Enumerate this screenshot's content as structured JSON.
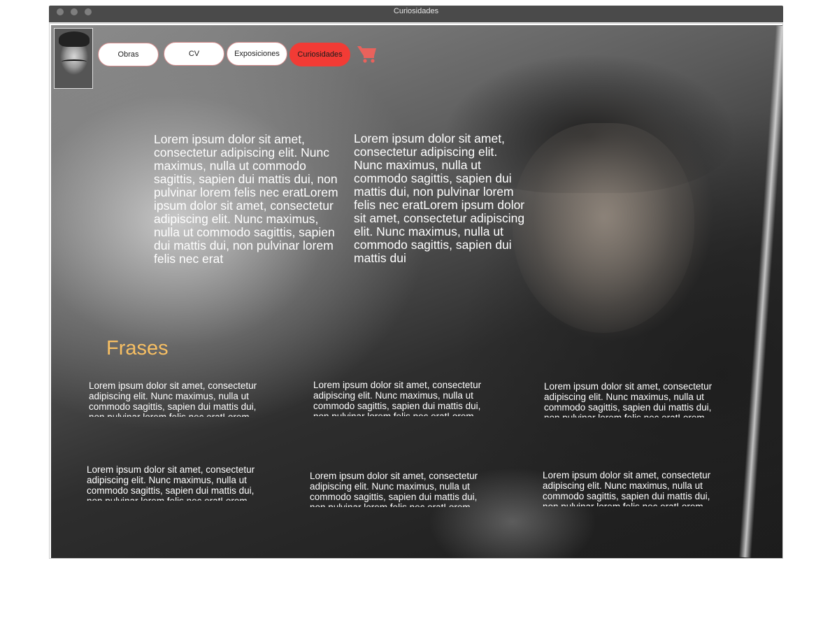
{
  "window": {
    "title": "Curiosidades"
  },
  "nav": {
    "items": [
      {
        "label": "Obras"
      },
      {
        "label": "CV"
      },
      {
        "label": "Exposiciones"
      },
      {
        "label": "Curiosidades",
        "active": true
      }
    ],
    "cart_icon": "shopping-cart-icon",
    "accent_color": "#f23b35"
  },
  "intro": {
    "col1": "Lorem ipsum dolor sit amet, consectetur adipiscing elit. Nunc maximus, nulla ut commodo sagittis, sapien dui mattis dui, non pulvinar lorem felis nec eratLorem ipsum dolor sit amet, consectetur adipiscing elit. Nunc maximus, nulla ut commodo sagittis, sapien dui mattis dui, non pulvinar lorem felis nec erat",
    "col2": "Lorem ipsum dolor sit amet, consectetur adipiscing elit. Nunc maximus, nulla ut commodo sagittis, sapien dui mattis dui, non pulvinar lorem felis nec eratLorem ipsum dolor sit amet, consectetur adipiscing elit. Nunc maximus, nulla ut commodo sagittis, sapien dui mattis dui"
  },
  "frases": {
    "heading": "Frases",
    "heading_color": "#f7bf63",
    "quotes": [
      "Lorem ipsum dolor sit amet, consectetur adipiscing elit. Nunc maximus, nulla ut commodo sagittis, sapien dui mattis dui, non pulvinar lorem felis nec eratLorem",
      "Lorem ipsum dolor sit amet, consectetur adipiscing elit. Nunc maximus, nulla ut commodo sagittis, sapien dui mattis dui, non pulvinar lorem felis nec eratLorem",
      "Lorem ipsum dolor sit amet, consectetur adipiscing elit. Nunc maximus, nulla ut commodo sagittis, sapien dui mattis dui, non pulvinar lorem felis nec eratLorem",
      "Lorem ipsum dolor sit amet, consectetur adipiscing elit. Nunc maximus, nulla ut commodo sagittis, sapien dui mattis dui, non pulvinar lorem felis nec eratLorem",
      "Lorem ipsum dolor sit amet, consectetur adipiscing elit. Nunc maximus, nulla ut commodo sagittis, sapien dui mattis dui, non pulvinar lorem felis nec eratLorem",
      "Lorem ipsum dolor sit amet, consectetur adipiscing elit. Nunc maximus, nulla ut commodo sagittis, sapien dui mattis dui, non pulvinar lorem felis nec eratLorem"
    ]
  }
}
